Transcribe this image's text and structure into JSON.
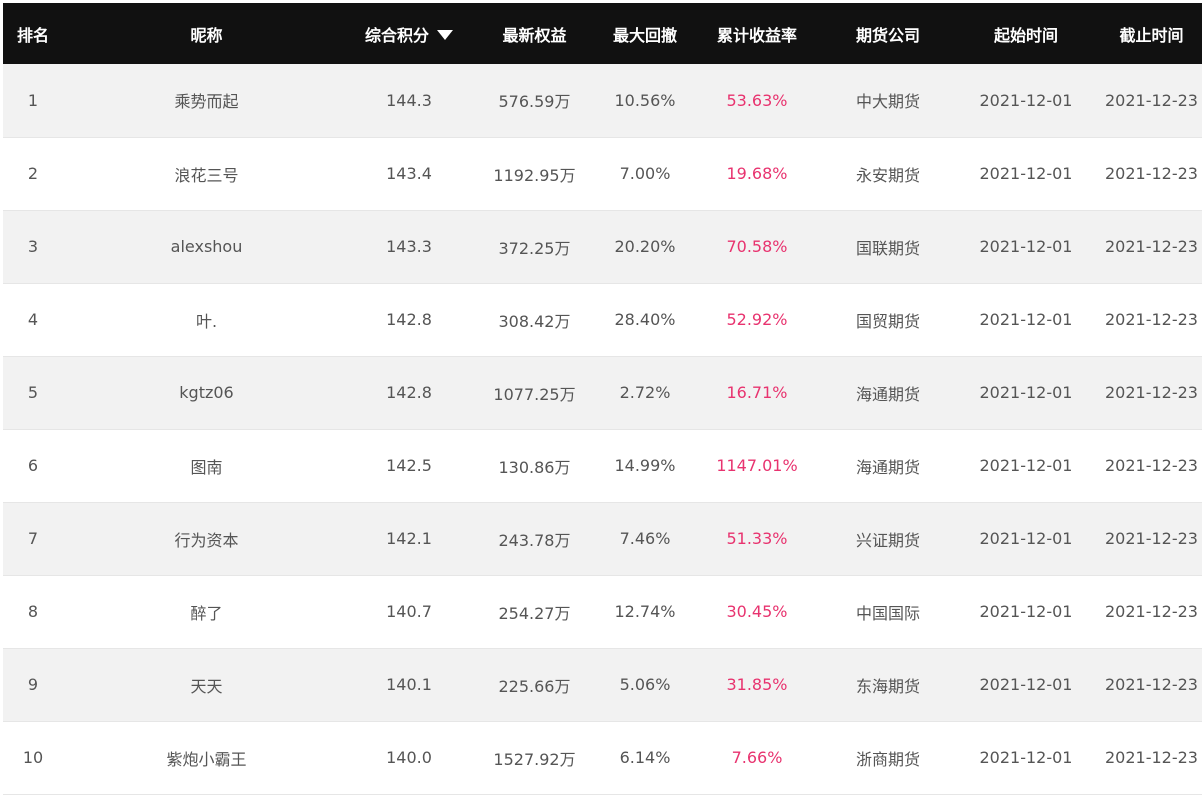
{
  "header": {
    "rank": "排名",
    "nickname": "昵称",
    "score": "综合积分",
    "equity": "最新权益",
    "drawdown": "最大回撤",
    "return_rate": "累计收益率",
    "broker": "期货公司",
    "start": "起始时间",
    "end": "截止时间",
    "sort_icon": "triangle-down-icon"
  },
  "colors": {
    "header_bg": "#111111",
    "rate": "#e8336f",
    "row_alt": "#f2f2f2"
  },
  "rows": [
    {
      "rank": "1",
      "nickname": "乘势而起",
      "score": "144.3",
      "equity": "576.59万",
      "drawdown": "10.56%",
      "return_rate": "53.63%",
      "broker": "中大期货",
      "start": "2021-12-01",
      "end": "2021-12-23"
    },
    {
      "rank": "2",
      "nickname": "浪花三号",
      "score": "143.4",
      "equity": "1192.95万",
      "drawdown": "7.00%",
      "return_rate": "19.68%",
      "broker": "永安期货",
      "start": "2021-12-01",
      "end": "2021-12-23"
    },
    {
      "rank": "3",
      "nickname": "alexshou",
      "score": "143.3",
      "equity": "372.25万",
      "drawdown": "20.20%",
      "return_rate": "70.58%",
      "broker": "国联期货",
      "start": "2021-12-01",
      "end": "2021-12-23"
    },
    {
      "rank": "4",
      "nickname": "叶.",
      "score": "142.8",
      "equity": "308.42万",
      "drawdown": "28.40%",
      "return_rate": "52.92%",
      "broker": "国贸期货",
      "start": "2021-12-01",
      "end": "2021-12-23"
    },
    {
      "rank": "5",
      "nickname": "kgtz06",
      "score": "142.8",
      "equity": "1077.25万",
      "drawdown": "2.72%",
      "return_rate": "16.71%",
      "broker": "海通期货",
      "start": "2021-12-01",
      "end": "2021-12-23"
    },
    {
      "rank": "6",
      "nickname": "图南",
      "score": "142.5",
      "equity": "130.86万",
      "drawdown": "14.99%",
      "return_rate": "1147.01%",
      "broker": "海通期货",
      "start": "2021-12-01",
      "end": "2021-12-23"
    },
    {
      "rank": "7",
      "nickname": "行为资本",
      "score": "142.1",
      "equity": "243.78万",
      "drawdown": "7.46%",
      "return_rate": "51.33%",
      "broker": "兴证期货",
      "start": "2021-12-01",
      "end": "2021-12-23"
    },
    {
      "rank": "8",
      "nickname": "醉了",
      "score": "140.7",
      "equity": "254.27万",
      "drawdown": "12.74%",
      "return_rate": "30.45%",
      "broker": "中国国际",
      "start": "2021-12-01",
      "end": "2021-12-23"
    },
    {
      "rank": "9",
      "nickname": "天天",
      "score": "140.1",
      "equity": "225.66万",
      "drawdown": "5.06%",
      "return_rate": "31.85%",
      "broker": "东海期货",
      "start": "2021-12-01",
      "end": "2021-12-23"
    },
    {
      "rank": "10",
      "nickname": "紫炮小霸王",
      "score": "140.0",
      "equity": "1527.92万",
      "drawdown": "6.14%",
      "return_rate": "7.66%",
      "broker": "浙商期货",
      "start": "2021-12-01",
      "end": "2021-12-23"
    }
  ]
}
